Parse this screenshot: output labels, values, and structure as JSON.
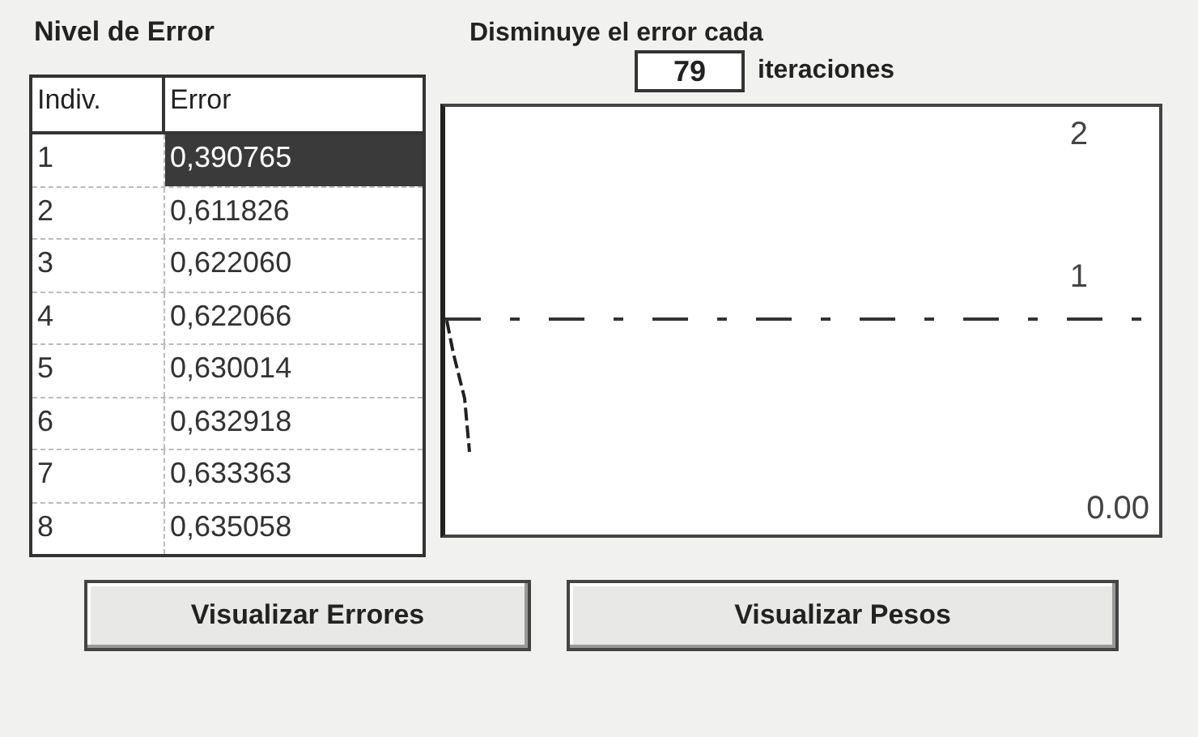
{
  "error_panel": {
    "title": "Nivel de Error",
    "table": {
      "columns": [
        "Indiv.",
        "Error"
      ],
      "rows": [
        {
          "cells": [
            "1",
            "0,390765"
          ],
          "selected": true
        },
        {
          "cells": [
            "2",
            "0,611826"
          ],
          "selected": false
        },
        {
          "cells": [
            "3",
            "0,622060"
          ],
          "selected": false
        },
        {
          "cells": [
            "4",
            "0,622066"
          ],
          "selected": false
        },
        {
          "cells": [
            "5",
            "0,630014"
          ],
          "selected": false
        },
        {
          "cells": [
            "6",
            "0,632918"
          ],
          "selected": false
        },
        {
          "cells": [
            "7",
            "0,633363"
          ],
          "selected": false
        },
        {
          "cells": [
            "8",
            "0,635058"
          ],
          "selected": false
        }
      ]
    }
  },
  "decrease": {
    "label": "Disminuye el error cada",
    "value": "79",
    "unit": "iteraciones"
  },
  "chart": {
    "labels": [
      "2",
      "1",
      "0.00"
    ]
  },
  "buttons": [
    "Visualizar Errores",
    "Visualizar Pesos"
  ]
}
